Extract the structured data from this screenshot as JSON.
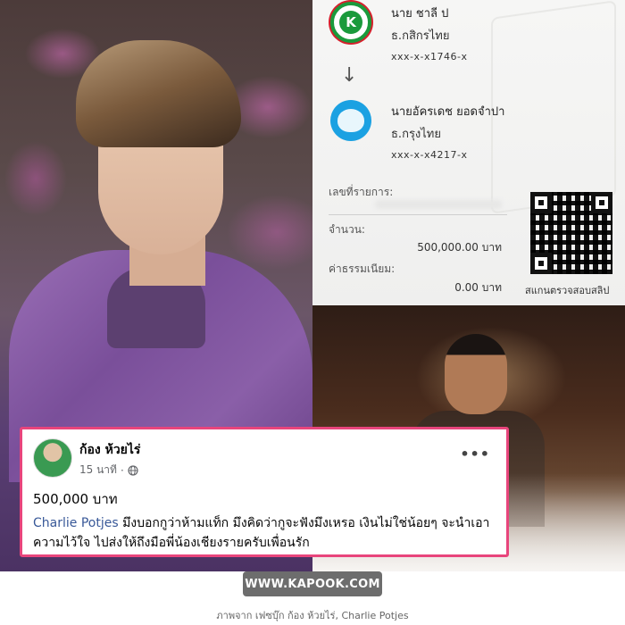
{
  "slip": {
    "sender": {
      "name": "นาย ชาลี ป",
      "bank": "ธ.กสิกรไทย",
      "account": "xxx-x-x1746-x"
    },
    "arrow": "↓",
    "receiver": {
      "name": "นายอัครเดช ยอดจำปา",
      "bank": "ธ.กรุงไทย",
      "account": "xxx-x-x4217-x"
    },
    "labels": {
      "reference": "เลขที่รายการ:",
      "amount": "จำนวน:",
      "fee": "ค่าธรรมเนียม:"
    },
    "amount": "500,000.00 บาท",
    "fee": "0.00 บาท",
    "qr_caption": "สแกนตรวจสอบสลิป",
    "colors": {
      "kbank": "#1a9a3c",
      "ktb": "#1ba1e2"
    }
  },
  "post": {
    "author": "ก้อง ห้วยไร่",
    "time": "15 นาที",
    "separator": "·",
    "more": "•••",
    "amount_line": "500,000 บาท",
    "mention": "Charlie Potjes",
    "text_rest": " มึงบอกกูว่าห้ามแท็ก มึงคิดว่ากูจะฟังมึงเหรอ เงินไม่ใช่น้อยๆ จะนำเอาความไว้ใจ ไปส่งให้ถึงมือพี่น้องเชียงรายครับเพื่อนรัก",
    "border_color": "#e8457c"
  },
  "footer": {
    "site": "WWW.KAPOOK.COM",
    "credit": "ภาพจาก เฟซบุ๊ก ก้อง ห้วยไร่, Charlie Potjes"
  }
}
